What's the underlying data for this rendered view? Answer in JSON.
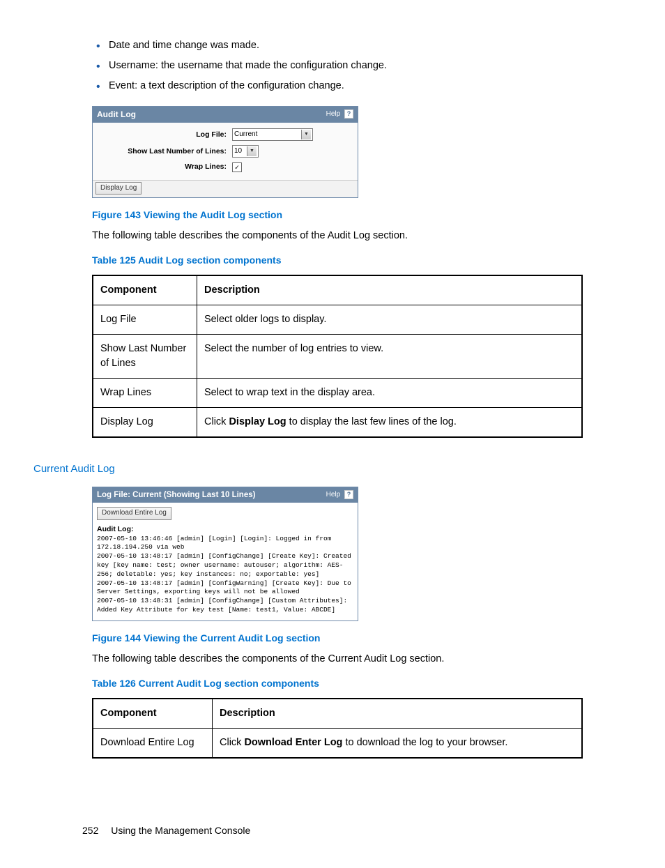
{
  "bullets": [
    "Date and time change was made.",
    "Username: the username that made the configuration change.",
    "Event: a text description of the configuration change."
  ],
  "auditPanel": {
    "title": "Audit Log",
    "help": "Help",
    "rows": {
      "logFileLabel": "Log File:",
      "logFileValue": "Current",
      "showLinesLabel": "Show Last Number of Lines:",
      "showLinesValue": "10",
      "wrapLabel": "Wrap Lines:",
      "wrapChecked": "✓"
    },
    "displayButton": "Display Log"
  },
  "fig143": "Figure 143 Viewing the Audit Log section",
  "para1": "The following table describes the components of the Audit Log section.",
  "tab125Caption": "Table 125 Audit Log section components",
  "table125": {
    "head": {
      "c1": "Component",
      "c2": "Description"
    },
    "rows": [
      {
        "c1": "Log File",
        "c2": "Select older logs to display."
      },
      {
        "c1": "Show Last Number of Lines",
        "c2": "Select the number of log entries to view."
      },
      {
        "c1": "Wrap Lines",
        "c2": "Select to wrap text in the display area."
      },
      {
        "c1": "Display Log",
        "c2_pre": "Click ",
        "c2_strong": "Display Log",
        "c2_post": " to display the last few lines of the log."
      }
    ]
  },
  "currentHeading": "Current Audit Log",
  "logPanel": {
    "title": "Log File: Current (Showing Last 10 Lines)",
    "help": "Help",
    "downloadButton": "Download Entire Log",
    "label": "Audit Log:",
    "content": "2007-05-10 13:46:46 [admin] [Login] [Login]: Logged in from 172.18.194.250 via web\n2007-05-10 13:48:17 [admin] [ConfigChange] [Create Key]: Created key [key name: test; owner username: autouser; algorithm: AES-256; deletable: yes; key instances: no; exportable: yes]\n2007-05-10 13:48:17 [admin] [ConfigWarning] [Create Key]: Due to Server Settings, exporting keys will not be allowed\n2007-05-10 13:48:31 [admin] [ConfigChange] [Custom Attributes]: Added Key Attribute for key test [Name: test1, Value: ABCDE]"
  },
  "fig144": "Figure 144 Viewing the Current Audit Log section",
  "para2": "The following table describes the components of the Current Audit Log section.",
  "tab126Caption": "Table 126 Current Audit Log section components",
  "table126": {
    "head": {
      "c1": "Component",
      "c2": "Description"
    },
    "row": {
      "c1": "Download Entire Log",
      "c2_pre": "Click ",
      "c2_strong": "Download Enter Log",
      "c2_post": " to download the log to your browser."
    }
  },
  "footer": {
    "page": "252",
    "chapter": "Using the Management Console"
  }
}
